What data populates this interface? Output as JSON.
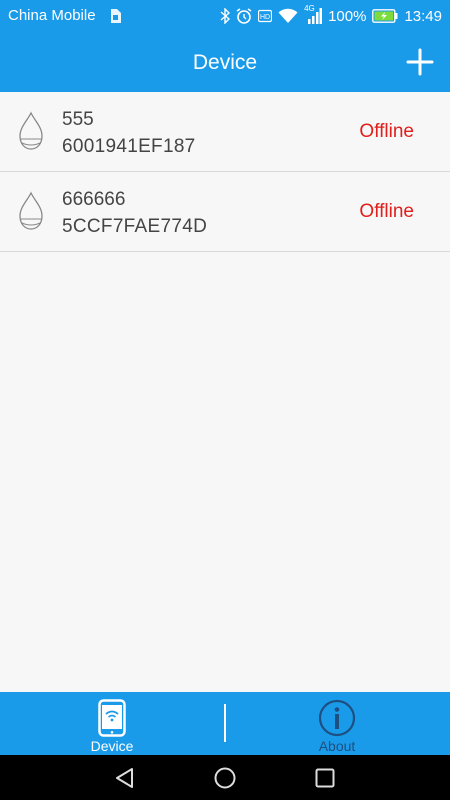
{
  "status_bar": {
    "carrier": "China Mobile",
    "network": "4G",
    "battery": "100%",
    "time": "13:49"
  },
  "app_bar": {
    "title": "Device",
    "add_icon": "plus-icon"
  },
  "devices": [
    {
      "name": "555",
      "mac": "6001941EF187",
      "status": "Offline",
      "icon": "diffuser-icon"
    },
    {
      "name": "666666",
      "mac": "5CCF7FAE774D",
      "status": "Offline",
      "icon": "diffuser-icon"
    }
  ],
  "tab_bar": {
    "tabs": [
      {
        "label": "Device",
        "icon": "phone-wifi-icon",
        "active": true
      },
      {
        "label": "About",
        "icon": "info-icon",
        "active": false
      }
    ]
  },
  "colors": {
    "primary": "#1a9bea",
    "offline": "#e0201c",
    "inactive_tab": "#1d4f80",
    "text": "#444444"
  }
}
